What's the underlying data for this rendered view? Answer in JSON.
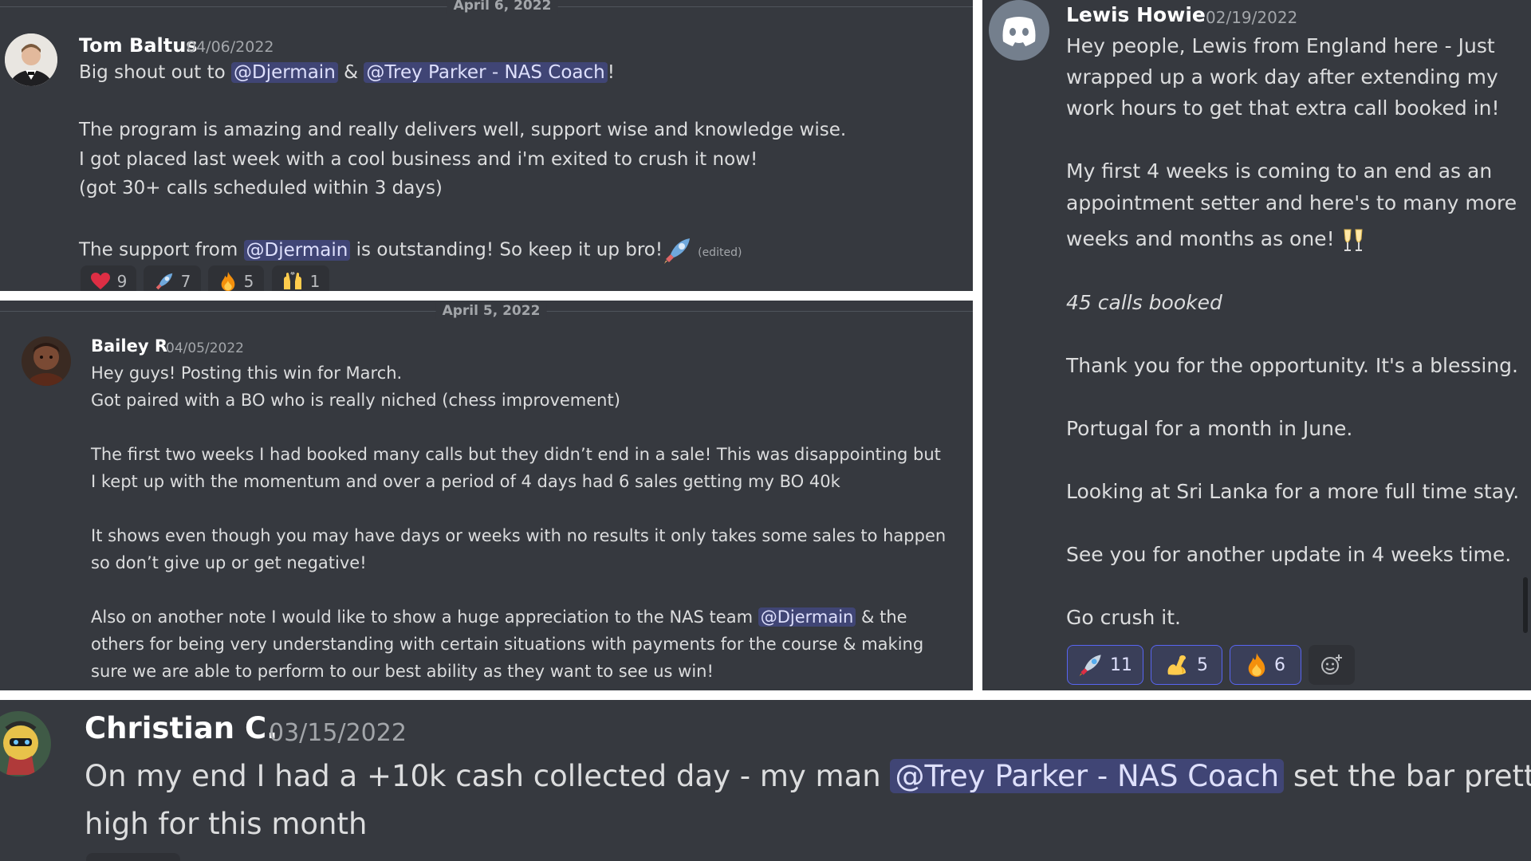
{
  "colors": {
    "background": "#36393f",
    "mention_bg": "#4a4f8a",
    "mention_text": "#dee0fc",
    "username": "#ffffff",
    "timestamp": "#a3a6aa",
    "text": "#dcddde",
    "reaction_bg": "#2f3136",
    "reaction_border": "#5865f2"
  },
  "msg1": {
    "date_divider": "April 6, 2022",
    "username": "Tom Baltus",
    "timestamp": "04/06/2022",
    "l1_pre": "Big shout out to ",
    "l1_m1": "@Djermain",
    "l1_mid": " & ",
    "l1_m2": "@Trey Parker - NAS Coach",
    "l1_post": "!",
    "l2": "The program is amazing and really delivers well, support wise and knowledge wise.",
    "l3": "I got placed last week with a cool business and i'm exited to crush it now!",
    "l4": "(got 30+ calls scheduled within 3 days)",
    "l5_pre": "The support from ",
    "l5_m": "@Djermain",
    "l5_post": " is outstanding! So keep it up bro!",
    "edited": "(edited)",
    "reactions": [
      {
        "icon": "heart-icon",
        "count": "9"
      },
      {
        "icon": "rocket-icon",
        "count": "7"
      },
      {
        "icon": "fire-icon",
        "count": "5"
      },
      {
        "icon": "raised-hands-icon",
        "count": "1"
      }
    ]
  },
  "msg2": {
    "date_divider": "April 5, 2022",
    "username": "Bailey R",
    "timestamp": "04/05/2022",
    "l1": "Hey guys! Posting this win for March.",
    "l2": "Got paired with a BO who is really niched (chess improvement)",
    "l3": "The first two weeks I had booked many calls but they didn’t end in a sale! This was disappointing but",
    "l4": "I kept up with the momentum and over a period of 4 days had 6 sales getting my BO 40k",
    "l5": "It shows even though you may have days or weeks with no results it only takes some sales to happen",
    "l6": "so don’t give up or get negative!",
    "l7_pre": "Also on another note I would like to show a huge appreciation to the NAS team ",
    "l7_m": "@Djermain",
    "l7_post": " & the",
    "l8": "others for being very understanding with certain situations with payments for the course & making",
    "l9": "sure we are able to perform to our best ability as they want to see us win!"
  },
  "msg3": {
    "username": "Lewis Howie",
    "timestamp": "02/19/2022",
    "l1": "Hey people, Lewis from England here - Just",
    "l2": "wrapped up a work day after extending my",
    "l3": "work hours to get that extra call booked in!",
    "l4": "My first 4 weeks is coming to an end as an",
    "l5": "appointment setter and here's to many more",
    "l6": "weeks and months as one!",
    "l7": "45 calls booked",
    "l8": "Thank you for the opportunity. It's a blessing.",
    "l9": "Portugal for a month in June.",
    "l10": "Looking at Sri Lanka for a more full time stay.",
    "l11": "See you for another update in 4 weeks time.",
    "l12": "Go crush it.",
    "reactions": [
      {
        "icon": "rocket-icon",
        "count": "11"
      },
      {
        "icon": "flexed-biceps-icon",
        "count": "5"
      },
      {
        "icon": "fire-icon",
        "count": "6"
      }
    ]
  },
  "msg4": {
    "username": "Christian C.",
    "timestamp": "03/15/2022",
    "l1_pre": "On my end I had a +10k cash collected day - my man ",
    "l1_m": "@Trey Parker - NAS Coach",
    "l1_post": " set the bar pretty",
    "l2": "high for this month"
  }
}
